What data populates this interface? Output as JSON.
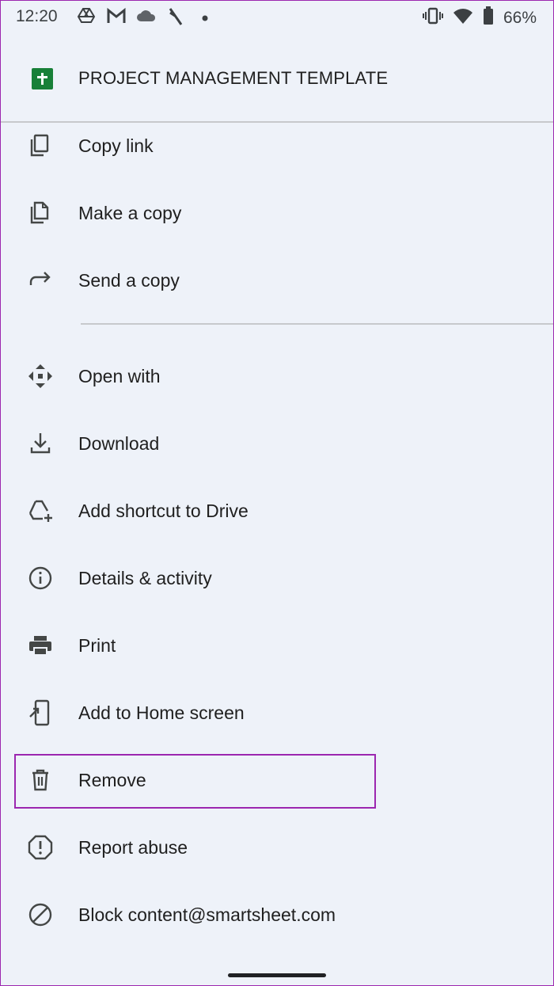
{
  "status_bar": {
    "time": "12:20",
    "battery_percent": "66%",
    "icons": [
      "drive-icon",
      "gmail-icon",
      "cloud-icon",
      "signal-mute-icon",
      "dot-icon",
      "vibrate-icon",
      "wifi-icon",
      "battery-icon"
    ]
  },
  "file": {
    "icon": "google-sheets-icon",
    "name": "PROJECT MANAGEMENT TEMPLATE"
  },
  "menu": {
    "items": [
      {
        "label": "Copy link",
        "icon": "copy-link-icon"
      },
      {
        "label": "Make a copy",
        "icon": "make-copy-icon"
      },
      {
        "label": "Send a copy",
        "icon": "share-arrow-icon"
      },
      {
        "label": "Open with",
        "icon": "open-with-icon"
      },
      {
        "label": "Download",
        "icon": "download-icon"
      },
      {
        "label": "Add shortcut to Drive",
        "icon": "drive-add-icon"
      },
      {
        "label": "Details & activity",
        "icon": "info-icon"
      },
      {
        "label": "Print",
        "icon": "print-icon"
      },
      {
        "label": "Add to Home screen",
        "icon": "add-home-screen-icon"
      },
      {
        "label": "Remove",
        "icon": "trash-icon"
      },
      {
        "label": "Report abuse",
        "icon": "report-icon"
      },
      {
        "label": "Block content@smartsheet.com",
        "icon": "block-icon"
      }
    ]
  },
  "colors": {
    "background": "#eef2f9",
    "highlight": "#9c27b0",
    "sheets_green": "#188038",
    "icon": "#444746"
  }
}
